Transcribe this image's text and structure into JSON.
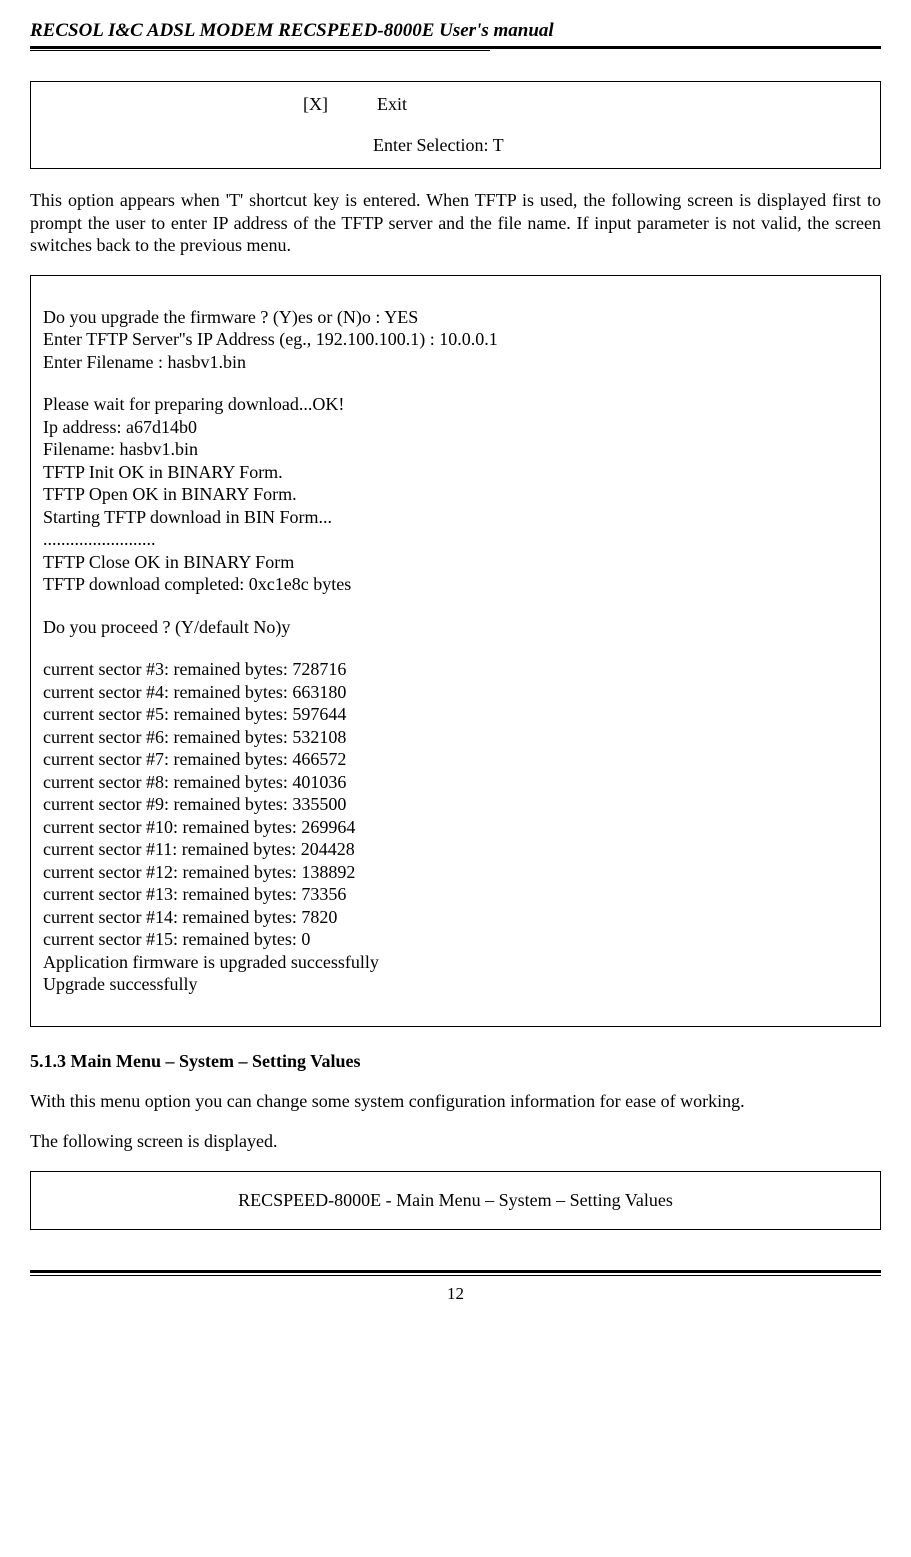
{
  "header": {
    "title": "RECSOL I&C ADSL  MODEM  RECSPEED-8000E  User's manual"
  },
  "box1": {
    "line1_key": "[X]",
    "line1_val": "Exit",
    "line2": "Enter Selection: T"
  },
  "para1": "This option appears when 'T' shortcut key is entered. When TFTP is used, the following screen is displayed first to prompt the user to enter IP address of the TFTP server and the file name. If input parameter is not valid, the screen switches back to the previous menu.",
  "terminal": {
    "l1": "Do you upgrade the firmware ? (Y)es or (N)o : YES",
    "l2": "Enter TFTP Server''s IP Address (eg., 192.100.100.1) : 10.0.0.1",
    "l3": "Enter Filename : hasbv1.bin",
    "l4": "Please wait for preparing download...OK!",
    "l5": "Ip address: a67d14b0",
    "l6": "Filename: hasbv1.bin",
    "l7": "TFTP Init OK in BINARY Form.",
    "l8": "TFTP Open OK in BINARY Form.",
    "l9": "Starting TFTP download in BIN Form...",
    "l10": ".........................",
    "l11": "TFTP Close OK in BINARY Form",
    "l12": "TFTP download completed: 0xc1e8c bytes",
    "l13": "Do you proceed ? (Y/default No)y",
    "l14": "current sector #3: remained bytes: 728716",
    "l15": "current sector #4: remained bytes: 663180",
    "l16": "current sector #5: remained bytes: 597644",
    "l17": "current sector #6: remained bytes: 532108",
    "l18": "current sector #7: remained bytes: 466572",
    "l19": "current sector #8: remained bytes: 401036",
    "l20": "current sector #9: remained bytes: 335500",
    "l21": "current sector #10: remained bytes: 269964",
    "l22": "current sector #11: remained bytes: 204428",
    "l23": "current sector #12: remained bytes: 138892",
    "l24": "current sector #13: remained bytes: 73356",
    "l25": "current sector #14: remained bytes: 7820",
    "l26": "current sector #15: remained bytes: 0",
    "l27": "Application firmware is upgraded successfully",
    "l28": "Upgrade successfully"
  },
  "section": {
    "heading": "5.1.3 Main Menu – System – Setting Values",
    "para": "With this menu option you can change some system configuration information for ease of working.",
    "para2": "The following screen is displayed."
  },
  "box2": {
    "title": "RECSPEED-8000E - Main Menu – System – Setting Values"
  },
  "footer": {
    "page": "12"
  }
}
